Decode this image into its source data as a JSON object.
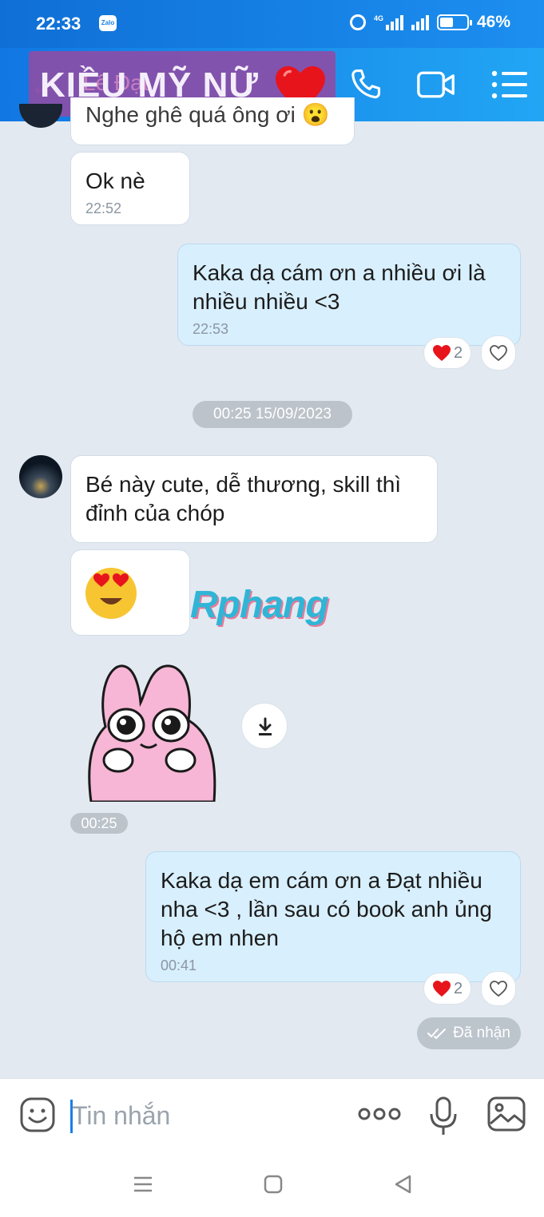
{
  "status_bar": {
    "time": "22:33",
    "app_badge": "Zalo",
    "network": "4G",
    "battery": "46%"
  },
  "header": {
    "contact_name_original": "Lê Đạt",
    "overlay_name": "KIỀU MỸ NỮ",
    "icons": [
      "back-arrow-icon",
      "phone-icon",
      "video-call-icon",
      "menu-list-icon"
    ]
  },
  "messages": {
    "partial_in": {
      "text": "Nghe ghê quá ông ơi 😮"
    },
    "in_ok": {
      "text": "Ok nè",
      "time": "22:52"
    },
    "out_1": {
      "text": "Kaka dạ cám ơn a nhiều ơi là nhiều nhiều <3",
      "time": "22:53",
      "reaction_count": "2"
    },
    "date_separator": "00:25 15/09/2023",
    "in_2": {
      "text": "Bé này cute, dễ thương, skill thì đỉnh của chóp"
    },
    "in_sticker_time": "00:25",
    "out_2": {
      "text": "Kaka dạ em cám ơn a Đạt nhiều nha <3 , lần sau có book anh ủng hộ em nhen",
      "time": "00:41",
      "reaction_count": "2"
    },
    "seen_status": "Đã nhận"
  },
  "watermark": "Rphang",
  "input": {
    "placeholder": "Tin nhắn"
  },
  "colors": {
    "header_start": "#1177e3",
    "header_end": "#22a6f4",
    "outgoing_bubble": "#d8effd",
    "incoming_bubble": "#ffffff",
    "chat_bg": "#e2e9f1",
    "accent": "#1a7fe6"
  }
}
